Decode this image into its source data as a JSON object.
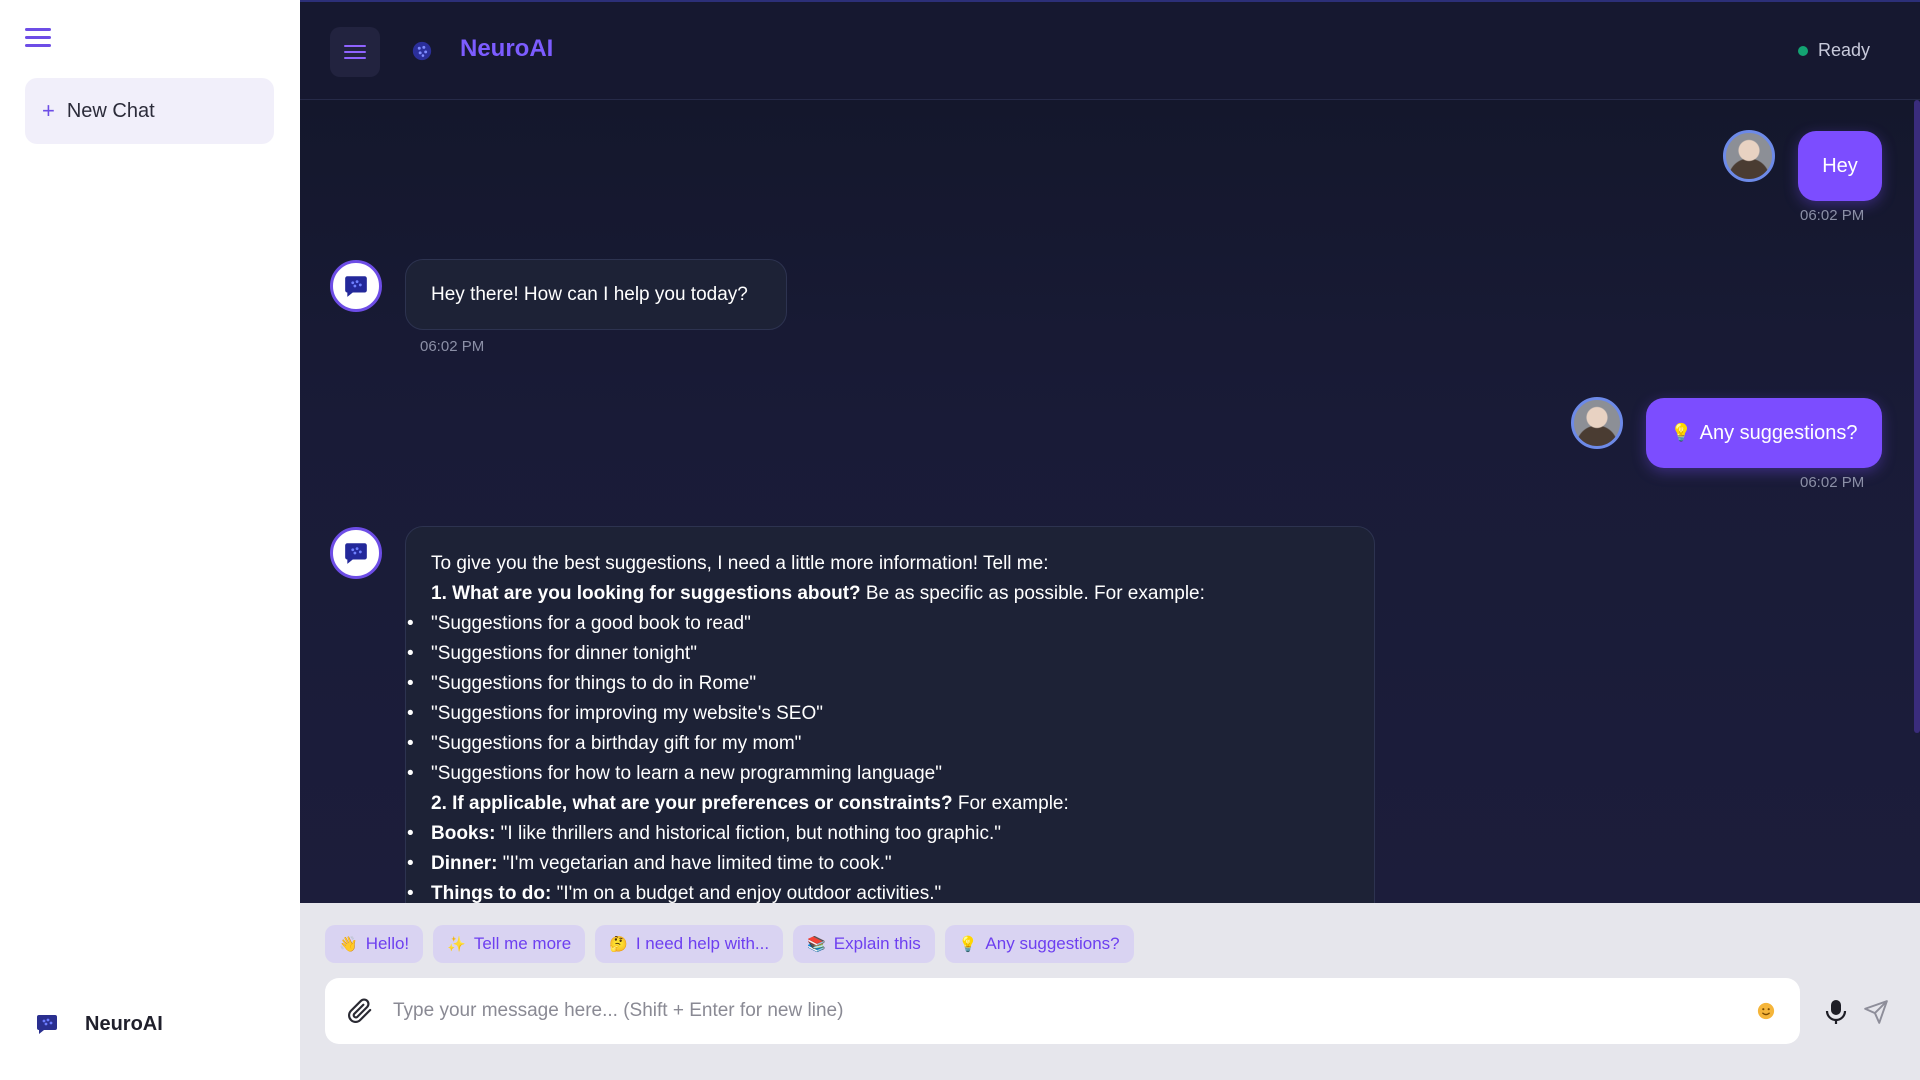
{
  "app": {
    "name": "NeuroAI"
  },
  "sidebar": {
    "new_chat_label": "New Chat",
    "brand_name": "NeuroAI"
  },
  "header": {
    "title": "NeuroAI",
    "status": "Ready"
  },
  "messages": [
    {
      "role": "user",
      "text": "Hey",
      "time": "06:02 PM"
    },
    {
      "role": "assistant",
      "text": "Hey there! How can I help you today?",
      "time": "06:02 PM"
    },
    {
      "role": "user",
      "icon": "💡",
      "text": "Any suggestions?",
      "time": "06:02 PM"
    },
    {
      "role": "assistant",
      "intro": "To give you the best suggestions, I need a little more information! Tell me:",
      "q1_bold": "1. What are you looking for suggestions about?",
      "q1_rest": " Be as specific as possible. For example:",
      "list1": [
        "\"Suggestions for a good book to read\"",
        "\"Suggestions for dinner tonight\"",
        "\"Suggestions for things to do in Rome\"",
        "\"Suggestions for improving my website's SEO\"",
        "\"Suggestions for a birthday gift for my mom\"",
        "\"Suggestions for how to learn a new programming language\""
      ],
      "q2_bold": "2. If applicable, what are your preferences or constraints?",
      "q2_rest": " For example:",
      "list2": [
        {
          "label": "Books:",
          "text": " \"I like thrillers and historical fiction, but nothing too graphic.\""
        },
        {
          "label": "Dinner:",
          "text": " \"I'm vegetarian and have limited time to cook.\""
        },
        {
          "label": "Things to do:",
          "text": " \"I'm on a budget and enjoy outdoor activities.\""
        }
      ]
    }
  ],
  "quick_replies": [
    {
      "icon": "👋",
      "label": "Hello!"
    },
    {
      "icon": "✨",
      "label": "Tell me more"
    },
    {
      "icon": "🤔",
      "label": "I need help with..."
    },
    {
      "icon": "📚",
      "label": "Explain this"
    },
    {
      "icon": "💡",
      "label": "Any suggestions?"
    }
  ],
  "input": {
    "placeholder": "Type your message here... (Shift + Enter for new line)",
    "value": ""
  },
  "colors": {
    "accent": "#7c4dff",
    "header_bg": "#161830",
    "status_ok": "#13a372",
    "bottom_bg": "#e6e6ec"
  }
}
